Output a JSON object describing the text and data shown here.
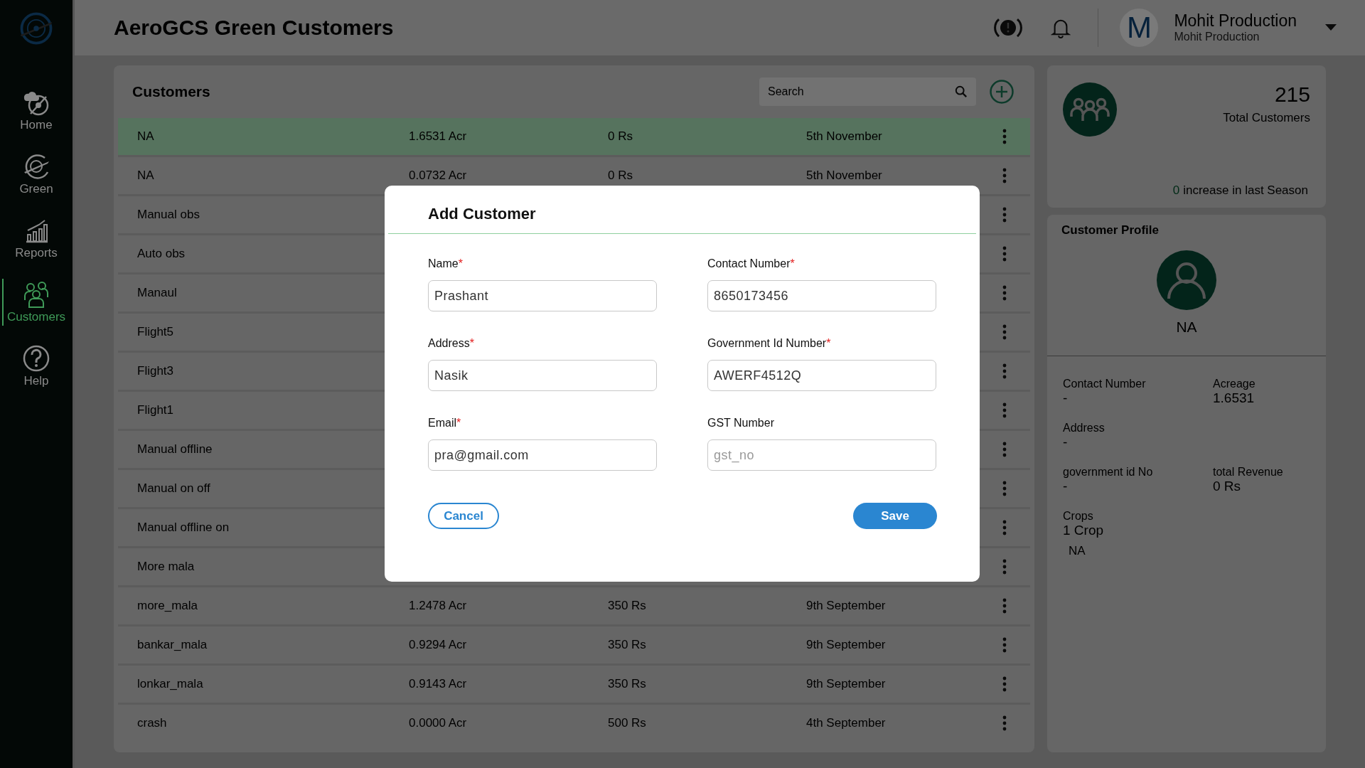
{
  "app": {
    "title": "AeroGCS Green Customers"
  },
  "sidebar": {
    "items": [
      {
        "label": "Home",
        "kind": "home",
        "selected": false
      },
      {
        "label": "Green",
        "kind": "green",
        "selected": false
      },
      {
        "label": "Reports",
        "kind": "reports",
        "selected": false
      },
      {
        "label": "Customers",
        "kind": "customers",
        "selected": true
      },
      {
        "label": "Help",
        "kind": "help",
        "selected": false
      }
    ]
  },
  "header": {
    "user": {
      "initial": "M",
      "name": "Mohit Production",
      "role": "Mohit Production"
    }
  },
  "customers": {
    "title": "Customers",
    "search": {
      "placeholder": "Search"
    },
    "rows": [
      {
        "name": "NA",
        "acreage": "1.6531 Acr",
        "revenue": "0 Rs",
        "date": "5th November",
        "selected": true
      },
      {
        "name": "NA",
        "acreage": "0.0732 Acr",
        "revenue": "0 Rs",
        "date": "5th November",
        "selected": false
      },
      {
        "name": "Manual obs",
        "selected": false
      },
      {
        "name": "Auto obs",
        "selected": false
      },
      {
        "name": "Manaul",
        "selected": false
      },
      {
        "name": "Flight5",
        "selected": false
      },
      {
        "name": "Flight3",
        "selected": false
      },
      {
        "name": "Flight1",
        "selected": false
      },
      {
        "name": "Manual offline",
        "selected": false
      },
      {
        "name": "Manual on off",
        "selected": false
      },
      {
        "name": "Manual offline on",
        "selected": false
      },
      {
        "name": "More mala",
        "selected": false
      },
      {
        "name": "more_mala",
        "acreage": "1.2478 Acr",
        "revenue": "350 Rs",
        "date": "9th September",
        "selected": false
      },
      {
        "name": "bankar_mala",
        "acreage": "0.9294 Acr",
        "revenue": "350 Rs",
        "date": "9th September",
        "selected": false
      },
      {
        "name": "lonkar_mala",
        "acreage": "0.9143 Acr",
        "revenue": "350 Rs",
        "date": "9th September",
        "selected": false
      },
      {
        "name": "crash",
        "acreage": "0.0000 Acr",
        "revenue": "500 Rs",
        "date": "4th September",
        "selected": false
      }
    ]
  },
  "summary": {
    "count": "215",
    "label": "Total Customers",
    "increase": "0",
    "increase_text": "increase in last Season"
  },
  "profile": {
    "title": "Customer Profile",
    "name": "NA",
    "fields": [
      {
        "label": "Contact Number",
        "value": "-",
        "wide": false
      },
      {
        "label": "Acreage",
        "value": "1.6531",
        "wide": false
      },
      {
        "label": "Address",
        "value": "-",
        "wide": true
      },
      {
        "label": "government id No",
        "value": "-",
        "wide": false
      },
      {
        "label": "total Revenue",
        "value": "0 Rs",
        "wide": false
      },
      {
        "label": "Crops",
        "value": "1 Crop",
        "wide": true
      }
    ],
    "crops": [
      "NA"
    ]
  },
  "modal": {
    "title": "Add Customer",
    "fields": [
      {
        "label": "Name",
        "required_mark": "*",
        "value": "Prashant"
      },
      {
        "label": "Contact Number",
        "required_mark": "*",
        "value": "8650173456"
      },
      {
        "label": "Address",
        "required_mark": "*",
        "value": "Nasik"
      },
      {
        "label": "Government Id Number",
        "required_mark": "*",
        "value": "AWERF4512Q"
      },
      {
        "label": "Email",
        "required_mark": "*",
        "value": "pra@gmail.com"
      },
      {
        "label": "GST Number",
        "placeholder": "gst_no"
      }
    ],
    "buttons": [
      {
        "label": "Cancel",
        "kind": "secondary"
      },
      {
        "label": "Save",
        "kind": "primary"
      }
    ]
  }
}
